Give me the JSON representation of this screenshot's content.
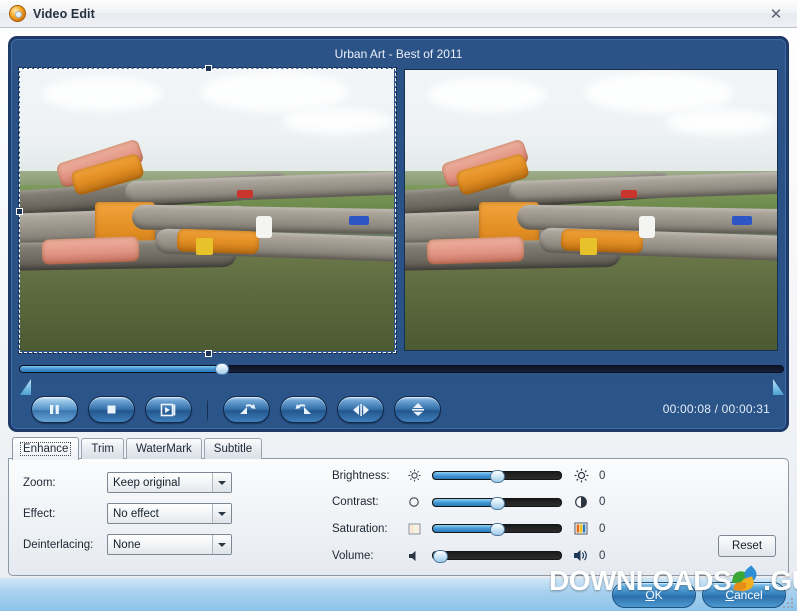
{
  "window": {
    "title": "Video Edit",
    "app_icon": "disc-icon",
    "close_label": "✕"
  },
  "video": {
    "clip_title": "Urban Art - Best of 2011",
    "preview_left_name": "crop-preview",
    "preview_right_name": "output-preview",
    "time_display": "00:00:08 / 00:00:31",
    "seek": {
      "position_percent": 26,
      "trim_start_label": "",
      "trim_end_label": ""
    },
    "transport": [
      {
        "name": "pause-button",
        "icon": "pause-icon",
        "state": "active"
      },
      {
        "name": "stop-button",
        "icon": "stop-icon",
        "state": "normal"
      },
      {
        "name": "snapshot-button",
        "icon": "snapshot-icon",
        "state": "normal"
      },
      {
        "name": "rotate-left-button",
        "icon": "rotate-left-icon",
        "state": "normal"
      },
      {
        "name": "rotate-right-button",
        "icon": "rotate-right-icon",
        "state": "normal"
      },
      {
        "name": "flip-horizontal-button",
        "icon": "flip-horizontal-icon",
        "state": "normal"
      },
      {
        "name": "flip-vertical-button",
        "icon": "flip-vertical-icon",
        "state": "normal"
      }
    ]
  },
  "tabs": [
    {
      "label": "Enhance",
      "active": true
    },
    {
      "label": "Trim",
      "active": false
    },
    {
      "label": "WaterMark",
      "active": false
    },
    {
      "label": "Subtitle",
      "active": false
    }
  ],
  "enhance": {
    "fields": [
      {
        "label": "Zoom:",
        "value": "Keep original"
      },
      {
        "label": "Effect:",
        "value": "No effect"
      },
      {
        "label": "Deinterlacing:",
        "value": "None"
      }
    ],
    "sliders": [
      {
        "label": "Brightness:",
        "value": "0",
        "percent": 50,
        "icon_small": "brightness-small-icon",
        "icon_large": "brightness-large-icon"
      },
      {
        "label": "Contrast:",
        "value": "0",
        "percent": 50,
        "icon_small": "contrast-small-icon",
        "icon_large": "contrast-large-icon"
      },
      {
        "label": "Saturation:",
        "value": "0",
        "percent": 50,
        "icon_small": "saturation-small-icon",
        "icon_large": "saturation-large-icon"
      },
      {
        "label": "Volume:",
        "value": "0",
        "percent": 2,
        "icon_small": "volume-small-icon",
        "icon_large": "volume-large-icon"
      }
    ],
    "reset_label": "Reset"
  },
  "footer": {
    "ok_label": "OK",
    "ok_accel": "O",
    "cancel_label": "Cancel",
    "cancel_accel": "C"
  },
  "watermark": {
    "text_left": "DOWNLOADS",
    "text_right": ".GURU"
  },
  "colors": {
    "panel_blue": "#2b5487",
    "panel_border": "#1e3a66",
    "accent_blue": "#3d8fd0",
    "bottom_bar": "#a9d2ef",
    "titlebar": "#eef0f4"
  }
}
